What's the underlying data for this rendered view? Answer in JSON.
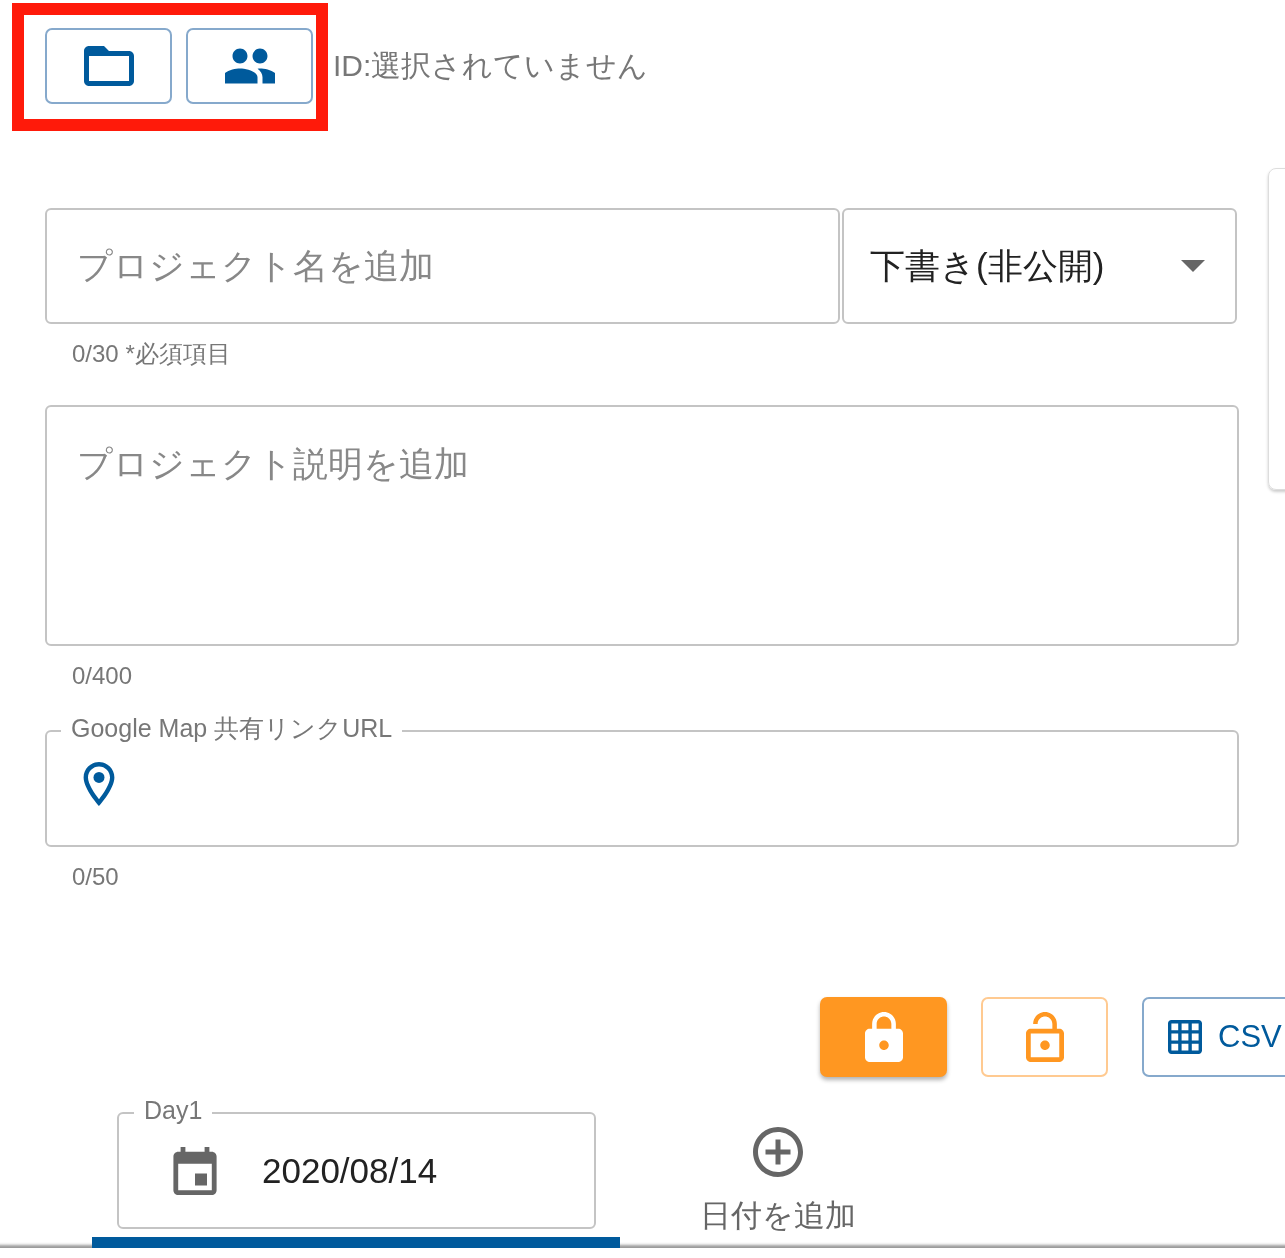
{
  "toolbar": {
    "buttons": [
      {
        "kind": "folder"
      },
      {
        "kind": "people"
      }
    ],
    "id_label": "ID:選択されていません"
  },
  "project_name": {
    "placeholder": "プロジェクト名を追加",
    "helper": "0/30 *必須項目"
  },
  "visibility": {
    "value": "下書き(非公開)"
  },
  "description": {
    "placeholder": "プロジェクト説明を追加",
    "counter": "0/400"
  },
  "map_url": {
    "label": "Google Map 共有リンクURL",
    "counter": "0/50"
  },
  "actions": [
    {
      "kind": "lock",
      "selected": true
    },
    {
      "kind": "unlock",
      "selected": false
    },
    {
      "kind": "csv",
      "label": "CSV"
    }
  ],
  "days": [
    {
      "label": "Day1",
      "date": "2020/08/14",
      "selected": true
    }
  ],
  "add_date": {
    "label": "日付を追加"
  }
}
